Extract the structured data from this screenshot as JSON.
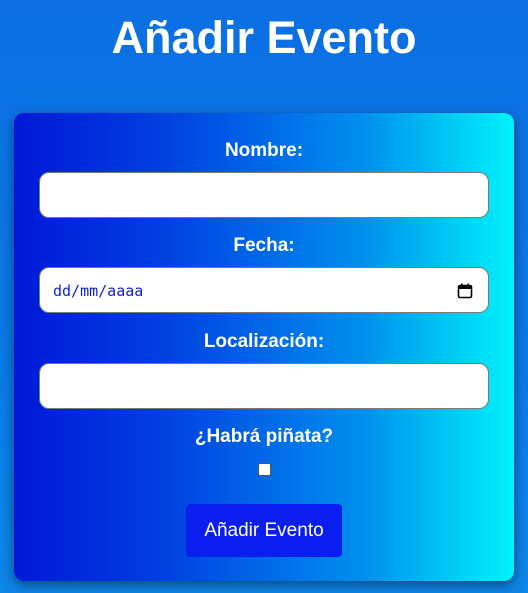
{
  "page": {
    "title": "Añadir Evento"
  },
  "form": {
    "name": {
      "label": "Nombre:",
      "value": ""
    },
    "date": {
      "label": "Fecha:",
      "placeholder": "dd/mm/aaaa",
      "icon": "calendar-icon"
    },
    "location": {
      "label": "Localización:",
      "value": ""
    },
    "pinata": {
      "label": "¿Habrá piñata?",
      "checked": false
    },
    "submit_label": "Añadir Evento"
  },
  "colors": {
    "page_background": "#0b72e4",
    "card_gradient_start": "#0018d8",
    "card_gradient_end": "#00f2fa",
    "button": "#0a1ef0",
    "date_text": "#0d21d8"
  }
}
